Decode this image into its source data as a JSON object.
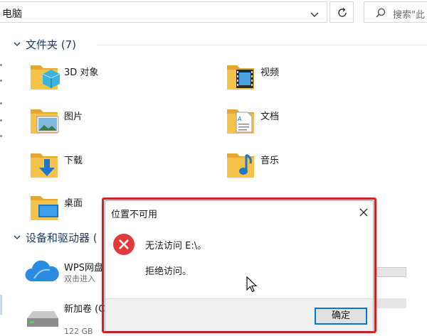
{
  "address": {
    "path": "电脑"
  },
  "search": {
    "placeholder": "搜索\"此"
  },
  "sections": {
    "folders_header": "文件夹 (7)",
    "devices_header": "设备和驱动器 ("
  },
  "folders": [
    {
      "label": "3D 对象",
      "icon": "3d-objects-icon"
    },
    {
      "label": "视频",
      "icon": "videos-icon"
    },
    {
      "label": "图片",
      "icon": "pictures-icon"
    },
    {
      "label": "文档",
      "icon": "documents-icon"
    },
    {
      "label": "下载",
      "icon": "downloads-icon"
    },
    {
      "label": "音乐",
      "icon": "music-icon"
    },
    {
      "label": "桌面",
      "icon": "desktop-icon"
    }
  ],
  "drives": [
    {
      "name": "WPS网盘",
      "sub": "双击进入",
      "icon": "cloud-drive-icon"
    },
    {
      "name": "新加卷 (C",
      "sub": "122 GB",
      "icon": "hard-drive-icon",
      "usage_fraction": 0.3
    }
  ],
  "dialog": {
    "title": "位置不可用",
    "message_line1": "无法访问 E:\\。",
    "message_line2": "拒绝访问。",
    "ok_label": "确定"
  },
  "colors": {
    "highlight_outline": "#d42a2a",
    "error_red": "#e03a3a",
    "folder_yellow": "#f5c24c",
    "accent_blue": "#0078d7"
  }
}
